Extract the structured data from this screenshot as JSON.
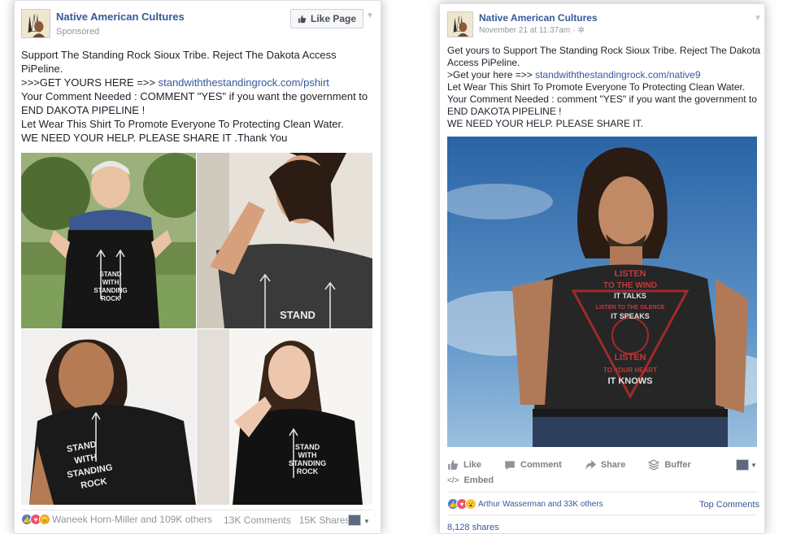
{
  "left_post": {
    "page_name": "Native American Cultures",
    "meta": "Sponsored",
    "like_button": "Like Page",
    "text_lines": [
      "Support The Standing Rock Sioux Tribe. Reject The Dakota Access",
      "PiPeline.",
      ">>>GET YOURS HERE =>> ",
      "Your Comment Needed : COMMENT \"YES\" if you want the government to",
      "END DAKOTA PIPELINE !",
      "Let Wear This Shirt To Promote Everyone To Protecting Clean Water.",
      "WE NEED YOUR HELP. PLEASE SHARE IT .Thank You"
    ],
    "link": "standwiththestandingrock.com/pshirt",
    "reactions_text": "Waneek Horn-Miller and 109K others",
    "comments": "13K Comments",
    "shares": "15K Shares",
    "shirt_text": [
      "STAND",
      "WITH",
      "STANDING",
      "ROCK"
    ],
    "shirt_text_b": [
      "STAND",
      "WITH",
      "STANDING",
      "ROCK"
    ]
  },
  "right_post": {
    "page_name": "Native American Cultures",
    "date": "November 21 at 11:37am",
    "text_lines": [
      "Get yours to Support The Standing Rock Sioux Tribe. Reject The Dakota",
      "Access PiPeline.",
      ">Get your here =>> ",
      "Let Wear This Shirt To Promote Everyone To Protecting Clean Water.",
      "Your Comment Needed : comment \"YES\" if you want the government to",
      "END DAKOTA PIPELINE !",
      "WE NEED YOUR HELP. PLEASE SHARE IT."
    ],
    "link": "standwiththestandingrock.com/native9",
    "actions": {
      "like": "Like",
      "comment": "Comment",
      "share": "Share",
      "buffer": "Buffer",
      "embed": "Embed"
    },
    "reactions_text": "Arthur Wasserman and 33K others",
    "top_comments": "Top Comments",
    "shares": "8,128 shares",
    "shirt_lines": [
      "LISTEN",
      "TO THE WIND",
      "IT TALKS",
      "LISTEN TO THE SILENCE",
      "IT SPEAKS",
      "LISTEN",
      "TO YOUR HEART",
      "IT KNOWS"
    ]
  }
}
